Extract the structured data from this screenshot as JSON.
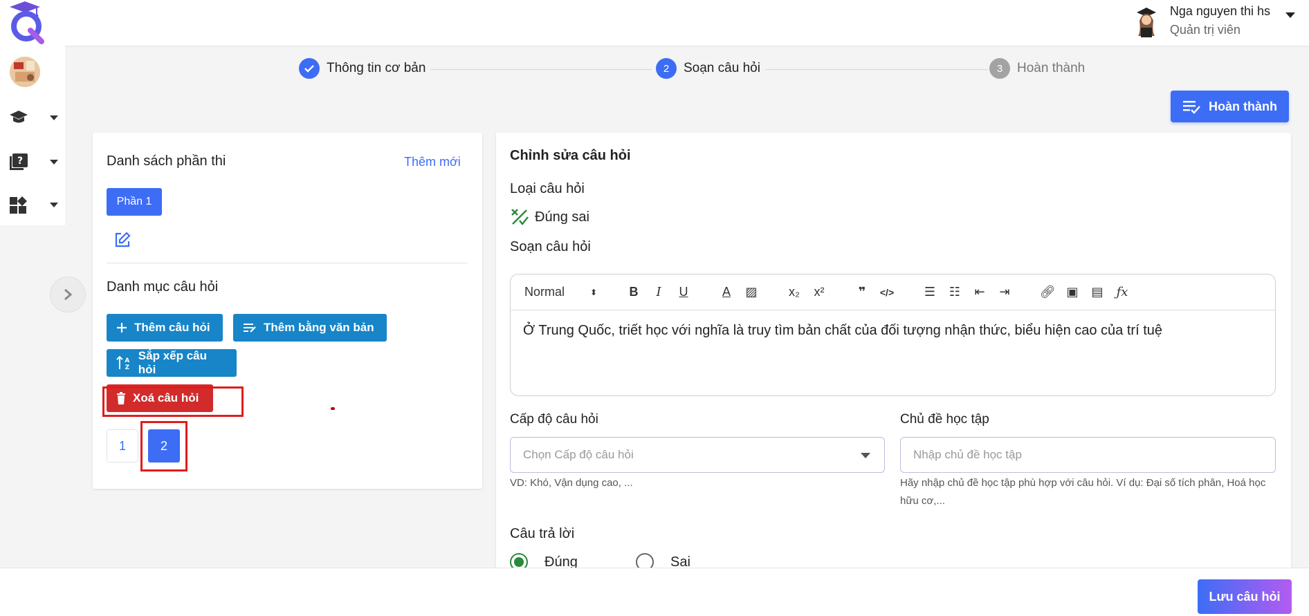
{
  "header": {
    "user_name": "Nga nguyen thi hs",
    "user_role": "Quản trị viên",
    "logo_icon": "graduation-cap-q-logo"
  },
  "sidebar": {
    "items": [
      {
        "icon": "graduation-cap-icon"
      },
      {
        "icon": "question-book-icon"
      },
      {
        "icon": "dashboard-add-icon"
      }
    ],
    "toggle_icon": "chevron-right-icon"
  },
  "stepper": {
    "steps": [
      {
        "number": "",
        "label": "Thông tin cơ bản",
        "state": "done"
      },
      {
        "number": "2",
        "label": "Soạn câu hỏi",
        "state": "active"
      },
      {
        "number": "3",
        "label": "Hoàn thành",
        "state": "pending"
      }
    ]
  },
  "actions": {
    "finish_label": "Hoàn thành",
    "save_label": "Lưu câu hỏi"
  },
  "left_panel": {
    "title": "Danh sách phần thi",
    "add_new": "Thêm mới",
    "parts": [
      "Phần 1"
    ],
    "category_title": "Danh mục câu hỏi",
    "buttons": {
      "add_question": "Thêm câu hỏi",
      "add_by_text": "Thêm bằng văn bản",
      "sort_questions": "Sắp xếp câu hỏi",
      "delete_question": "Xoá câu hỏi"
    },
    "pages": [
      "1",
      "2"
    ],
    "active_page": "2"
  },
  "right_panel": {
    "title": "Chỉnh sửa câu hỏi",
    "question_type_label": "Loại câu hỏi",
    "question_type_value": "Đúng sai",
    "compose_label": "Soạn câu hỏi",
    "editor": {
      "format_select": "Normal",
      "content": "Ở Trung Quốc, triết học với nghĩa là truy tìm bản chất của đối tượng nhận thức, biểu hiện cao của trí tuệ"
    },
    "level": {
      "label": "Cấp độ câu hỏi",
      "placeholder": "Chọn Cấp độ câu hỏi",
      "hint": "VD: Khó, Vận dụng cao, ..."
    },
    "topic": {
      "label": "Chủ đề học tập",
      "placeholder": "Nhập chủ đề học tập",
      "hint": "Hãy nhập chủ đề học tập phù hợp với câu hỏi. Ví dụ: Đại số tích phân, Hoá học hữu cơ,..."
    },
    "answer": {
      "label": "Câu trả lời",
      "options": [
        "Đúng",
        "Sai"
      ],
      "selected": "Đúng"
    }
  },
  "colors": {
    "primary": "#3d6df5",
    "action_blue": "#1785c8",
    "danger": "#d22b2b",
    "success": "#2a8a3a",
    "highlight_box": "#e01c1c"
  }
}
